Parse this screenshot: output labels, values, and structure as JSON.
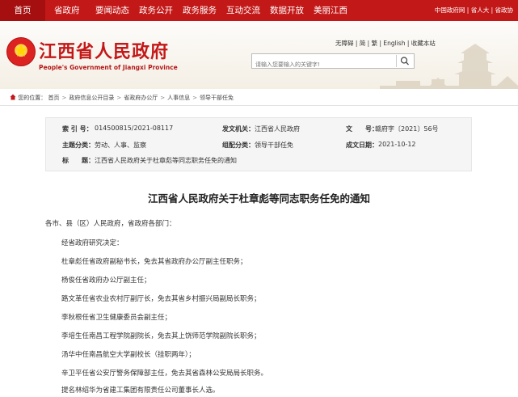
{
  "nav": {
    "items": [
      "首页",
      "省政府",
      "要闻动态",
      "政务公开",
      "政务服务",
      "互动交流",
      "数据开放",
      "美丽江西"
    ],
    "right": {
      "link1": "中国政府网",
      "sep": " | ",
      "link2": "省人大",
      "sep2": " | ",
      "link3": "省政协"
    }
  },
  "header": {
    "title": "江西省人民政府",
    "subtitle": "People's Government of Jiangxi Province",
    "links": [
      "无障碍",
      "简",
      "繁",
      "English",
      "收藏本站"
    ],
    "search_placeholder": "请输入您要输入的关键字!"
  },
  "breadcrumb": {
    "prefix": "您的位置：",
    "items": [
      "首页",
      "政府信息公开目录",
      "省政府办公厅",
      "人事信息",
      "领导干部任免"
    ]
  },
  "info": {
    "index_label": "索 引 号：",
    "index": "014500815/2021-08117",
    "issuer_label": "发文机关：",
    "issuer": "江西省人民政府",
    "docno_label": "文　　号：",
    "docno": "赣府字〔2021〕56号",
    "topic_label": "主题分类：",
    "topic": "劳动、人事、监察",
    "group_label": "组配分类：",
    "group": "领导干部任免",
    "date_label": "成文日期：",
    "date": "2021-10-12",
    "title_label": "标　　题：",
    "title": "江西省人民政府关于杜章彪等同志职务任免的通知"
  },
  "article": {
    "title": "江西省人民政府关于杜章彪等同志职务任免的通知",
    "greeting": "各市、县（区）人民政府，省政府各部门：",
    "paragraphs": [
      "经省政府研究决定：",
      "杜章彪任省政府副秘书长，免去其省政府办公厅副主任职务；",
      "杨俊任省政府办公厅副主任；",
      "路文革任省农业农村厅副厅长，免去其省乡村振兴局副局长职务；",
      "李秋根任省卫生健康委员会副主任；",
      "李培生任南昌工程学院副院长，免去其上饶师范学院副院长职务；",
      "汤华中任南昌航空大学副校长（挂职两年）；",
      "辛卫平任省公安厅警务保障部主任，免去其省森林公安局局长职务。",
      "提名林绍华为省建工集团有限责任公司董事长人选。"
    ]
  }
}
